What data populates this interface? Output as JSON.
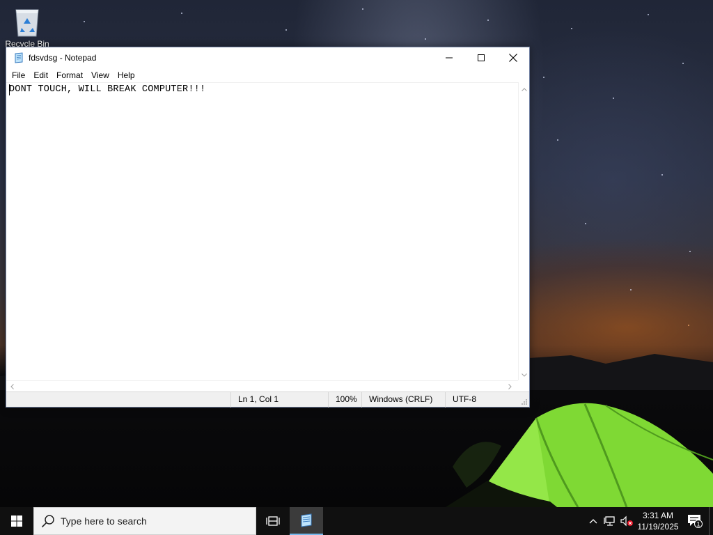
{
  "desktop": {
    "icons": [
      {
        "label": "Recycle Bin",
        "icon": "recycle-bin-icon"
      }
    ]
  },
  "notepad": {
    "title": "fdsvdsg - Notepad",
    "app_icon": "notepad-icon",
    "window_buttons": [
      "minimize-icon",
      "maximize-icon",
      "close-icon"
    ],
    "menu": [
      "File",
      "Edit",
      "Format",
      "View",
      "Help"
    ],
    "content": "DONT TOUCH, WILL BREAK COMPUTER!!!",
    "status": {
      "position": "Ln 1, Col 1",
      "zoom": "100%",
      "line_ending": "Windows (CRLF)",
      "encoding": "UTF-8"
    }
  },
  "taskbar": {
    "start_icon": "windows-logo-icon",
    "search": {
      "placeholder": "Type here to search",
      "icon": "search-icon"
    },
    "taskview_icon": "task-view-icon",
    "pinned": [
      {
        "name": "Notepad",
        "icon": "notepad-icon",
        "active": true
      }
    ],
    "tray": {
      "icons": [
        "chevron-up-icon",
        "network-icon",
        "volume-muted-icon"
      ],
      "time": "3:31 AM",
      "date": "11/19/2025",
      "notification_count": "1"
    }
  },
  "colors": {
    "taskbar_bg": "#101010",
    "active_app_underline": "#76b9ed",
    "tent": "#8ee63a"
  }
}
